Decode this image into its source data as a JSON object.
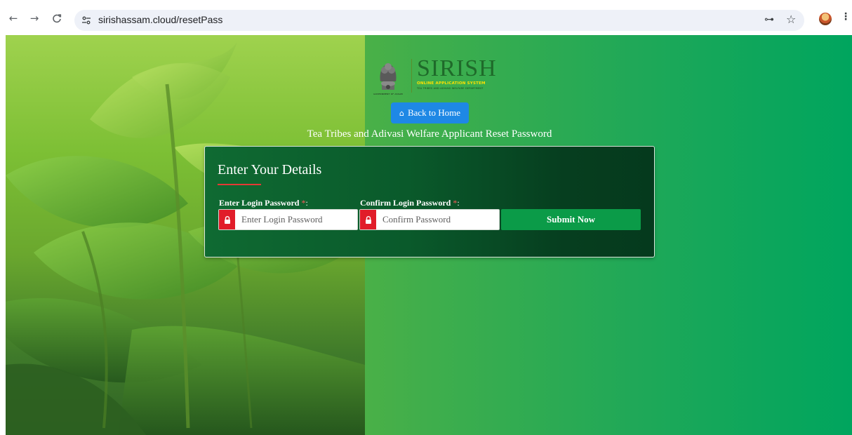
{
  "browser": {
    "back_icon": "←",
    "forward_icon": "→",
    "reload_icon": "C",
    "url": "sirishassam.cloud/resetPass",
    "password_key_icon": "⊶",
    "bookmark_icon": "☆",
    "menu_icon": "⋮"
  },
  "logo": {
    "brand": "SIRISH",
    "tagline": "ONLINE APPLICATION SYSTEM",
    "department": "TEA TRIBES AND ADIVASI WELFARE DEPARTMENT",
    "emblem_caption": "GOVERNMENT OF ASSAM"
  },
  "header": {
    "home_button_icon": "home-icon",
    "home_button_label": "Back to Home",
    "subtitle": "Tea Tribes and Adivasi Welfare Applicant Reset Password"
  },
  "form": {
    "title": "Enter Your Details",
    "password_label": "Enter Login Password",
    "password_placeholder": "Enter Login Password",
    "password_value": "",
    "confirm_label": "Confirm Login Password",
    "confirm_placeholder": "Confirm Password",
    "confirm_value": "",
    "required_mark": "*",
    "colon": ":",
    "submit_label": "Submit Now"
  },
  "colors": {
    "accent_blue": "#1e88e5",
    "required_red": "#e11d2a",
    "submit_green": "#0b9b48",
    "card_green": "#0a5a2b"
  }
}
